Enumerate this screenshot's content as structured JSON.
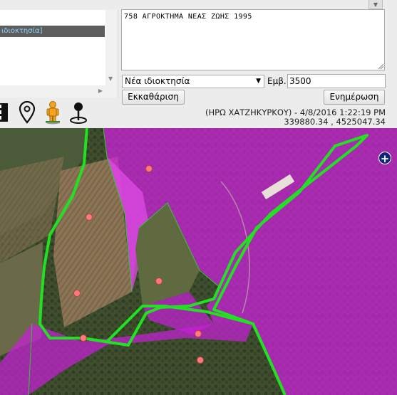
{
  "list": {
    "selected_item": "ιδιοκτησία]"
  },
  "form": {
    "description": "758 ΑΓΡΟΚΤΗΜΑ ΝΕΑΣ ΖΩΗΣ 1995",
    "ownership_type": "Νέα ιδιοκτησία",
    "area_label": "Εμβ.",
    "area_value": "3500",
    "clear_label": "Εκκαθάριση",
    "update_label": "Ενημέρωση"
  },
  "toolbar": {
    "icons": [
      "road-icon",
      "map-pin-icon",
      "street-view-person-icon",
      "place-marker-icon"
    ]
  },
  "info": {
    "user_timestamp": "(ΗΡΩ ΧΑΤΖΗΚΥΡΚΟΥ) - 4/8/2016 1:22:19 PM",
    "coordinates": "339880.34 , 4525047.34"
  },
  "map": {
    "zoom_in_label": "+",
    "overlay_color": "#d11fe0",
    "boundary_color": "#22e022",
    "marker_color": "#ff7a7a"
  }
}
